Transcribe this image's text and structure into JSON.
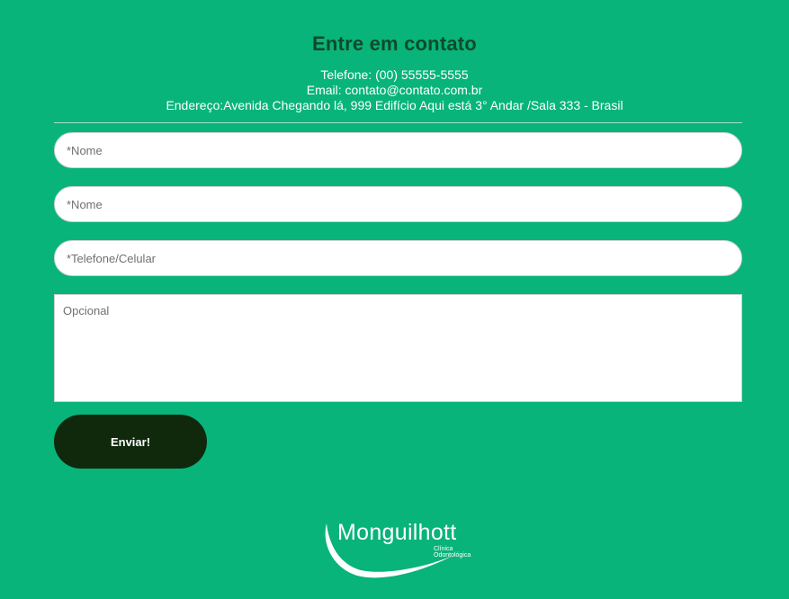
{
  "header": {
    "title": "Entre em contato",
    "phone": "Telefone: (00) 55555-5555",
    "email": "Email: contato@contato.com.br",
    "address": "Endereço:Avenida Chegando lá, 999 Edifício Aqui está 3° Andar /Sala 333 - Brasil"
  },
  "form": {
    "field1_placeholder": "*Nome",
    "field2_placeholder": "*Nome",
    "field3_placeholder": "*Telefone/Celular",
    "message_placeholder": "Opcional",
    "submit_label": "Enviar!"
  },
  "logo": {
    "name": "Monguilhott",
    "tagline": "Clínica Odontológica"
  },
  "colors": {
    "background": "#08b47a",
    "title": "#0f4a2a",
    "button": "#10290c"
  }
}
